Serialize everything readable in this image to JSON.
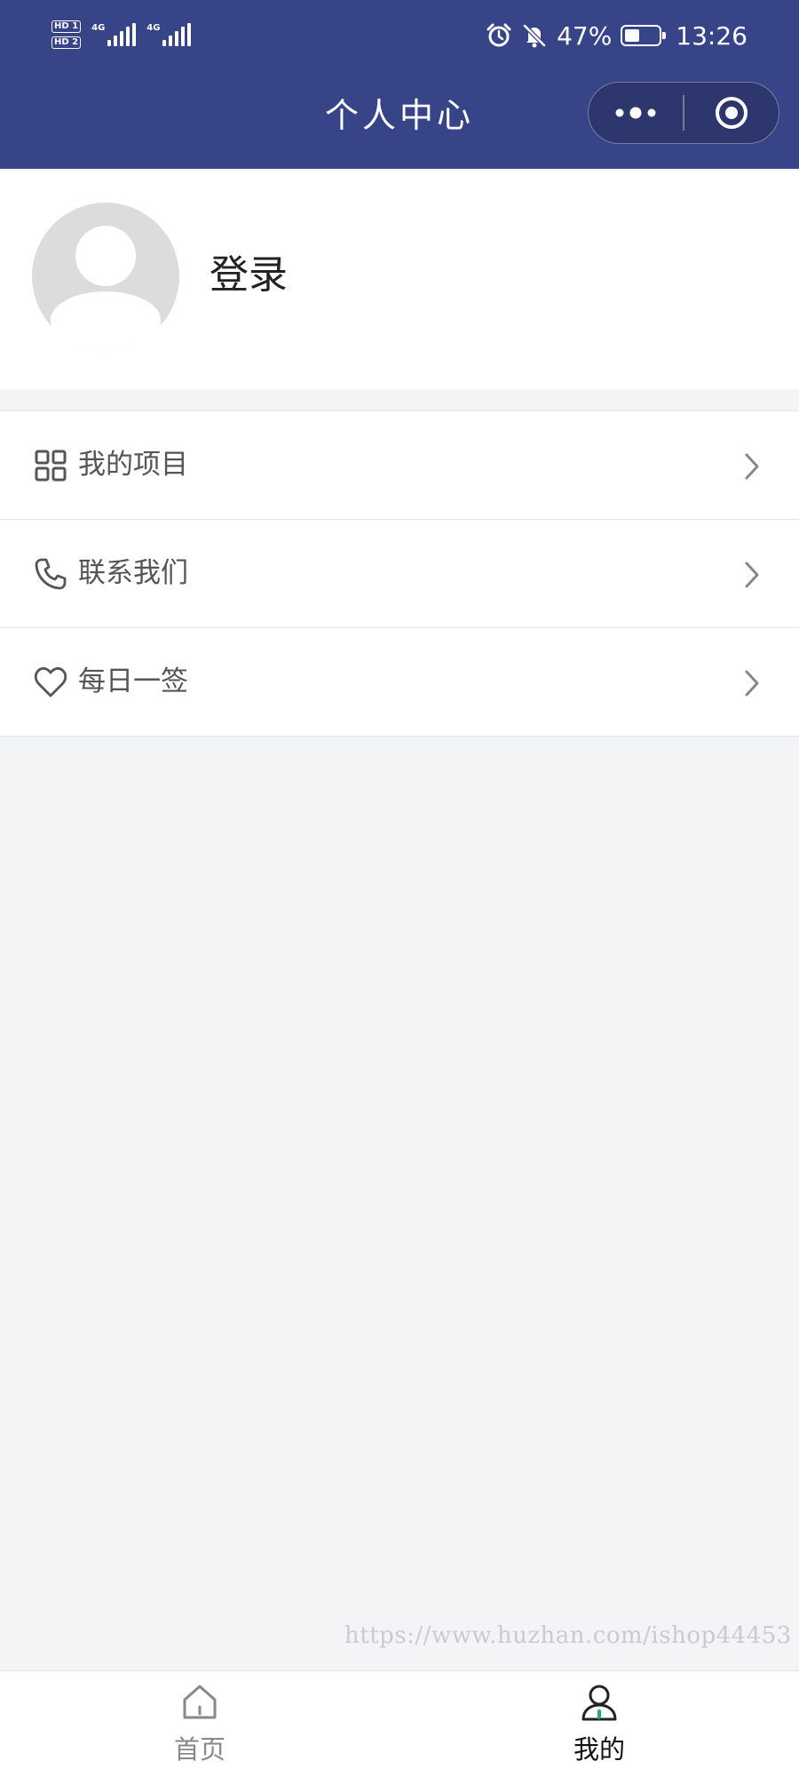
{
  "status_bar": {
    "sim1": "HD 1",
    "sim2": "HD 2",
    "network1": "4G",
    "network2": "4G",
    "battery_percent_text": "47%",
    "battery_level": 0.47,
    "time": "13:26",
    "icons": [
      "alarm-icon",
      "bell-muted-icon",
      "battery-icon"
    ]
  },
  "header": {
    "title": "个人中心",
    "background": "#374487",
    "capsule": {
      "more_icon": "more-dots-icon",
      "close_icon": "target-icon"
    }
  },
  "profile": {
    "login_label": "登录",
    "avatar_icon": "default-avatar-icon"
  },
  "menu": [
    {
      "label": "我的项目",
      "icon": "grid-icon"
    },
    {
      "label": "联系我们",
      "icon": "phone-icon"
    },
    {
      "label": "每日一签",
      "icon": "heart-icon"
    }
  ],
  "watermark": "https://www.huzhan.com/ishop44453",
  "tabbar": {
    "items": [
      {
        "label": "首页",
        "icon": "home-icon",
        "active": false
      },
      {
        "label": "我的",
        "icon": "user-icon",
        "active": true
      }
    ],
    "active_color": "#111111",
    "inactive_color": "#888888",
    "accent": "#1aa88a"
  }
}
